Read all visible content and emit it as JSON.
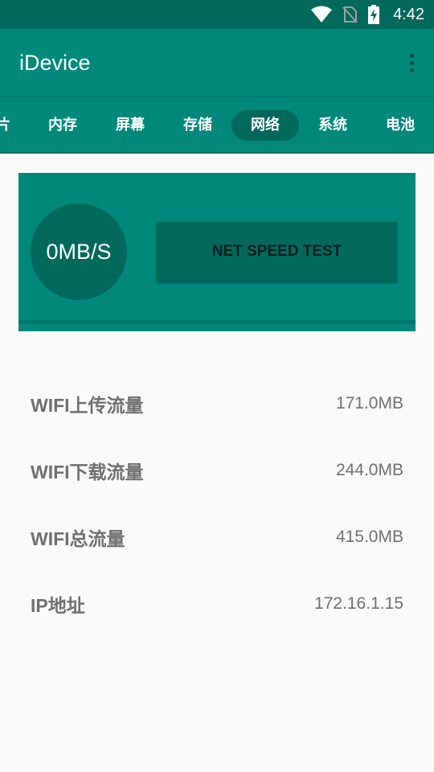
{
  "status_bar": {
    "time": "4:42",
    "icons": [
      "wifi-icon",
      "no-sim-icon",
      "battery-charging-icon"
    ]
  },
  "app_bar": {
    "title": "iDevice",
    "menu_icon": "more-vert-icon"
  },
  "tabs": [
    {
      "label": "图片",
      "visible_text": "片",
      "active": false
    },
    {
      "label": "内存",
      "active": false
    },
    {
      "label": "屏幕",
      "active": false
    },
    {
      "label": "存储",
      "active": false
    },
    {
      "label": "网络",
      "active": true
    },
    {
      "label": "系统",
      "active": false
    },
    {
      "label": "电池",
      "active": false
    }
  ],
  "speed_card": {
    "speed": "0MB/S",
    "button_label": "NET SPEED TEST"
  },
  "info": [
    {
      "label": "WIFI上传流量",
      "value": "171.0MB"
    },
    {
      "label": "WIFI下载流量",
      "value": "244.0MB"
    },
    {
      "label": "WIFI总流量",
      "value": "415.0MB"
    },
    {
      "label": "IP地址",
      "value": "172.16.1.15"
    }
  ],
  "colors": {
    "primary": "#00897b",
    "primary_dark": "#00695c",
    "background": "#fafafa",
    "text_secondary": "#707070"
  }
}
